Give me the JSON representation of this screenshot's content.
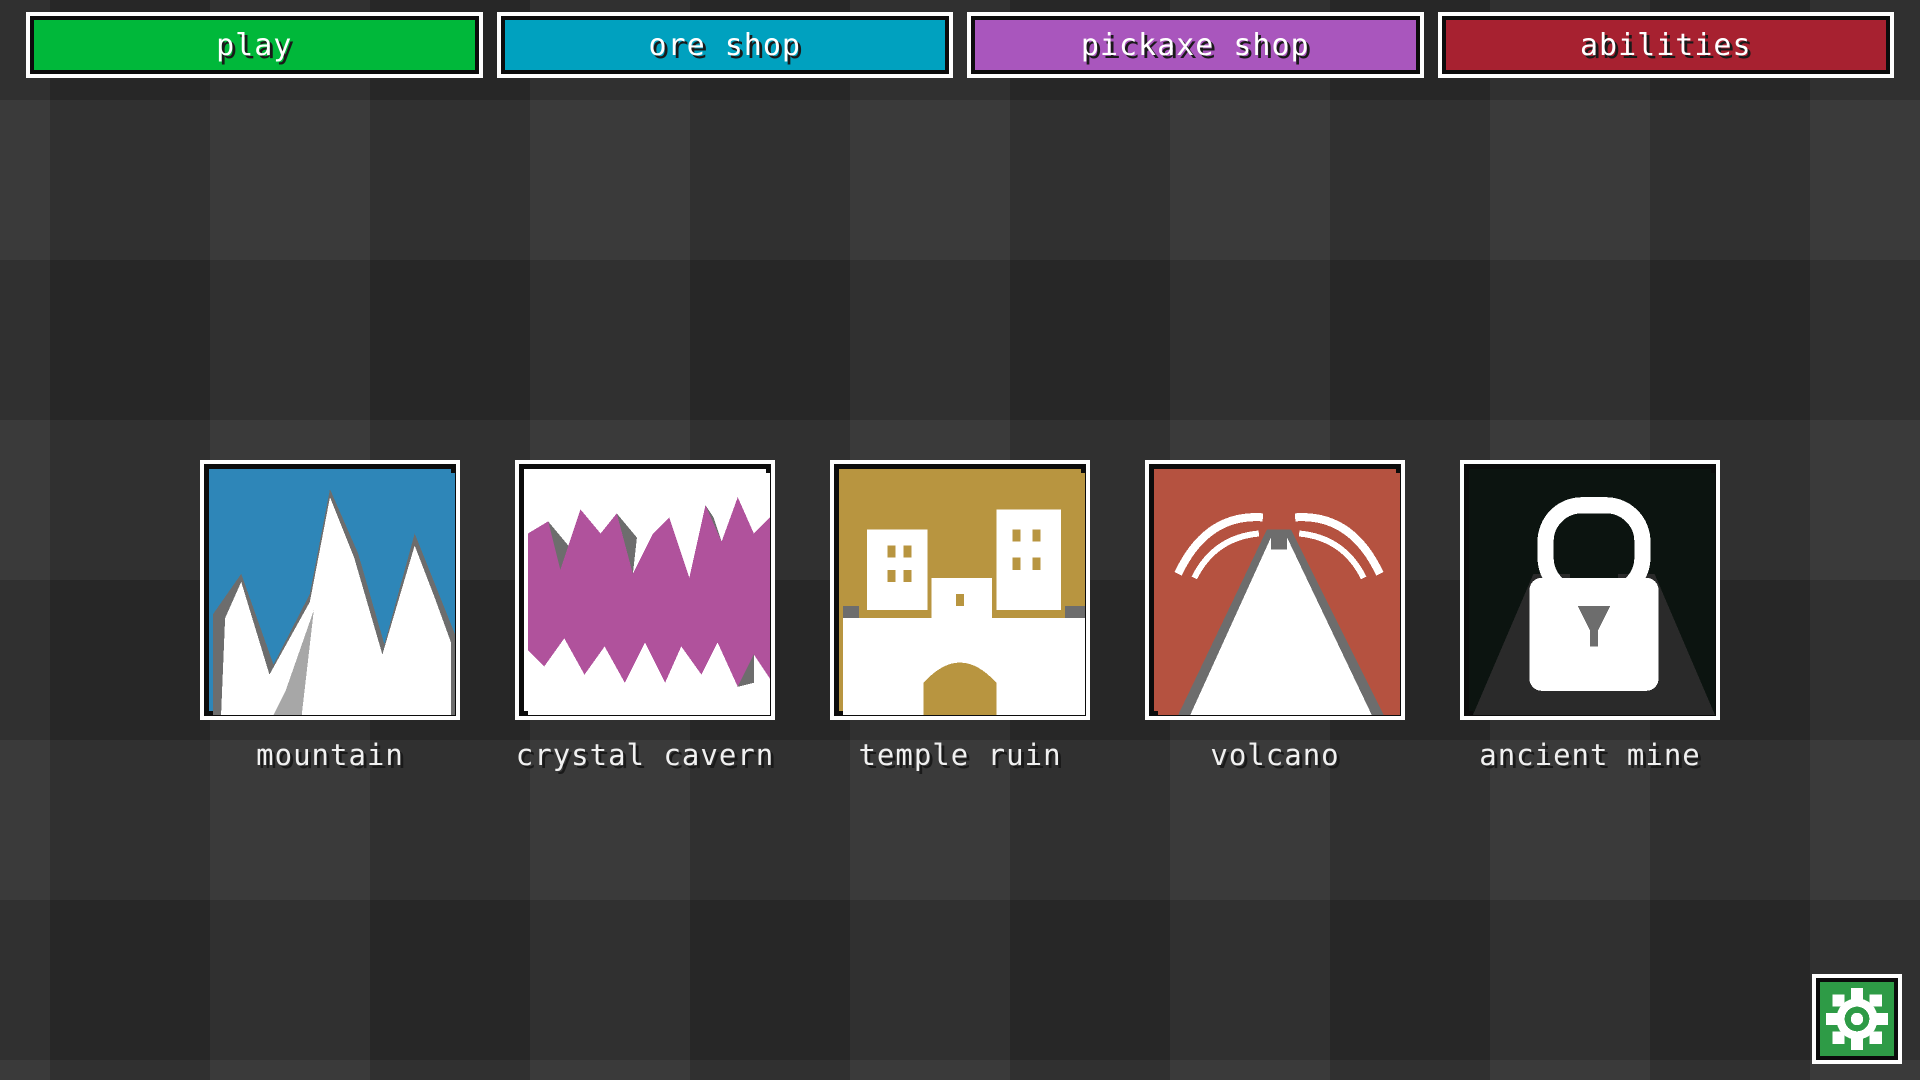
{
  "nav": {
    "buttons": [
      {
        "label": "play",
        "color": "#00b83a"
      },
      {
        "label": "ore shop",
        "color": "#00a1bf"
      },
      {
        "label": "pickaxe shop",
        "color": "#a956bd"
      },
      {
        "label": "abilities",
        "color": "#a72130"
      }
    ]
  },
  "levels": [
    {
      "label": "mountain",
      "icon": "mountain-icon",
      "bg": "#2e86b8"
    },
    {
      "label": "crystal cavern",
      "icon": "crystal-cavern-icon",
      "bg": "#ffffff",
      "accent": "#b0529c"
    },
    {
      "label": "temple ruin",
      "icon": "temple-ruin-icon",
      "bg": "#b89540"
    },
    {
      "label": "volcano",
      "icon": "volcano-icon",
      "bg": "#b55240"
    },
    {
      "label": "ancient mine",
      "icon": "lock-icon",
      "bg": "#0c1410",
      "locked": true
    }
  ],
  "settings": {
    "icon": "gear-icon",
    "color": "#2e9b46"
  }
}
